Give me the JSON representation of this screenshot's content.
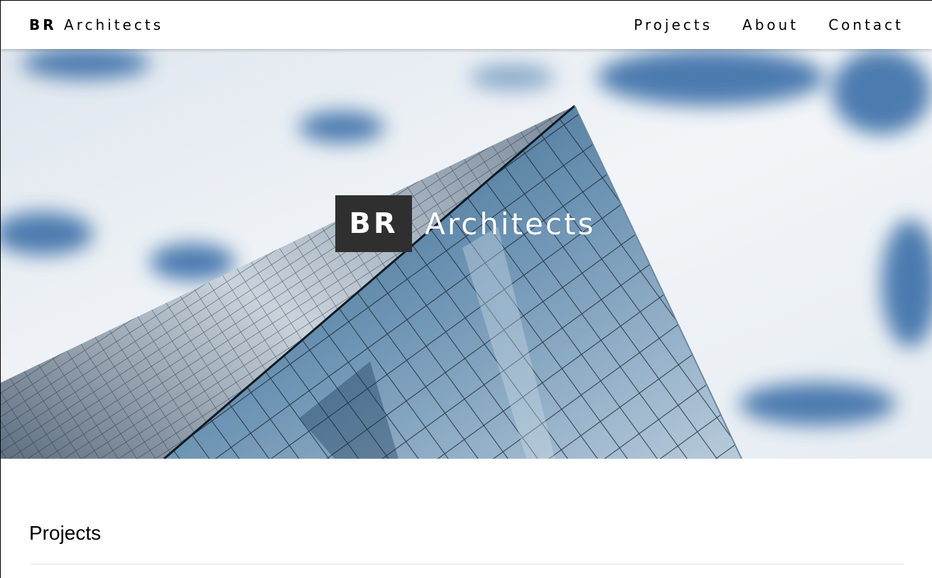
{
  "header": {
    "brand_bold": "BR",
    "brand_rest": "Architects",
    "nav": [
      {
        "label": "Projects"
      },
      {
        "label": "About"
      },
      {
        "label": "Contact"
      }
    ]
  },
  "hero": {
    "badge": "BR",
    "title": "Architects",
    "sky_color": "#3a6ea8",
    "glass_color": "#1e4766"
  },
  "main": {
    "section_title": "Projects"
  }
}
